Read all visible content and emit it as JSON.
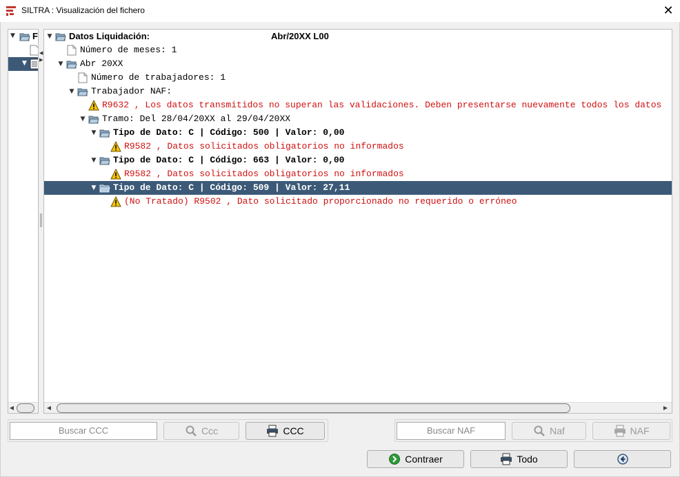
{
  "window": {
    "title": "SILTRA : Visualización del fichero",
    "close_glyph": "✕"
  },
  "left_tree": {
    "root_label": "F"
  },
  "tree": {
    "root": {
      "label": "Datos Liquidación:",
      "period": "Abr/20XX  L00"
    },
    "meses": "Número de meses: 1",
    "abr": "Abr 20XX",
    "trabajadores": "Número de trabajadores: 1",
    "naf": "Trabajador NAF:",
    "err1": "R9632 , Los datos transmitidos no superan las validaciones. Deben presentarse nuevamente todos los datos",
    "tramo": "Tramo: Del 28/04/20XX al 29/04/20XX",
    "tipo1": "Tipo de Dato: C | Código: 500 | Valor: 0,00",
    "err2": "R9582 , Datos solicitados obligatorios no informados",
    "tipo2": "Tipo de Dato: C | Código: 663 | Valor: 0,00",
    "err3": "R9582 , Datos solicitados obligatorios no informados",
    "tipo3": "Tipo de Dato: C | Código: 509 | Valor: 27,11",
    "err4": "(No Tratado) R9502 , Dato solicitado proporcionado no requerido o erróneo"
  },
  "controls": {
    "buscar_ccc_placeholder": "Buscar CCC",
    "ccc_search_button": "Ccc",
    "ccc_print_button": "CCC",
    "buscar_naf_placeholder": "Buscar NAF",
    "naf_search_button": "Naf",
    "naf_print_button": "NAF",
    "contraer_button": "Contraer",
    "todo_button": "Todo"
  },
  "colors": {
    "selection": "#3c5a78",
    "error_text": "#d01010",
    "warning": "#f5c400"
  }
}
